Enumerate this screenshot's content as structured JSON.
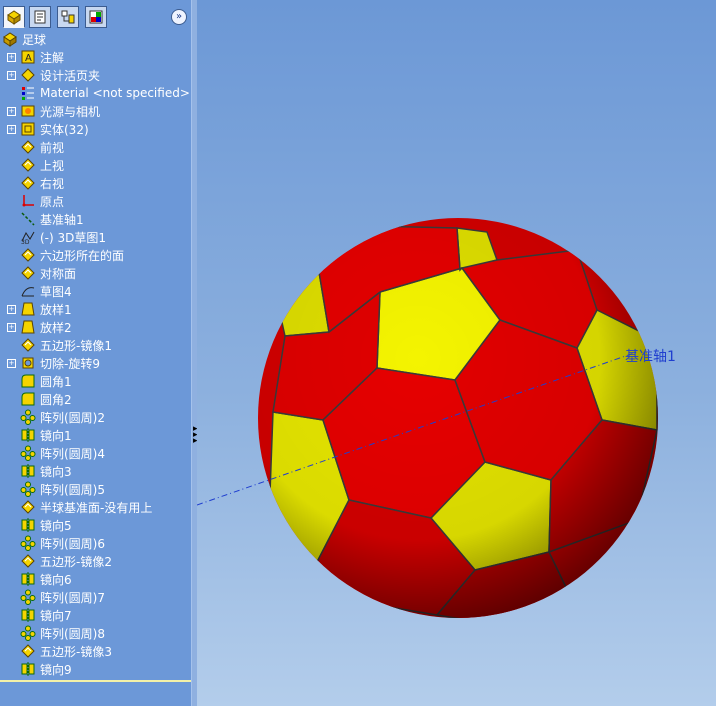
{
  "colors": {
    "panel": "#6c98d8",
    "ball_red": "#e00000",
    "ball_yellow": "#f0f000",
    "axis": "#1f3ecf"
  },
  "toolbar": {
    "tabs": [
      {
        "icon": "feature-manager-icon"
      },
      {
        "icon": "property-manager-icon"
      },
      {
        "icon": "configuration-manager-icon"
      },
      {
        "icon": "display-manager-icon"
      }
    ],
    "expand_glyph": "»"
  },
  "tree": {
    "items": [
      {
        "label": "足球",
        "icon": "part-icon",
        "expandable": false
      },
      {
        "label": "注解",
        "icon": "annotations-icon",
        "expandable": true
      },
      {
        "label": "设计活页夹",
        "icon": "design-binder-icon",
        "expandable": true
      },
      {
        "label": "Material <not specified>",
        "icon": "material-icon",
        "expandable": false
      },
      {
        "label": "光源与相机",
        "icon": "lights-cameras-icon",
        "expandable": true
      },
      {
        "label": "实体(32)",
        "icon": "solid-bodies-icon",
        "expandable": true
      },
      {
        "label": "前视",
        "icon": "plane-icon",
        "expandable": false
      },
      {
        "label": "上视",
        "icon": "plane-icon",
        "expandable": false
      },
      {
        "label": "右视",
        "icon": "plane-icon",
        "expandable": false
      },
      {
        "label": "原点",
        "icon": "origin-icon",
        "expandable": false
      },
      {
        "label": "基准轴1",
        "icon": "axis-icon",
        "expandable": false
      },
      {
        "label": "(-) 3D草图1",
        "icon": "sketch3d-icon",
        "expandable": false
      },
      {
        "label": "六边形所在的面",
        "icon": "plane-icon",
        "expandable": false
      },
      {
        "label": "对称面",
        "icon": "plane-icon",
        "expandable": false
      },
      {
        "label": "草图4",
        "icon": "sketch-icon",
        "expandable": false
      },
      {
        "label": "放样1",
        "icon": "loft-icon",
        "expandable": true
      },
      {
        "label": "放样2",
        "icon": "loft-icon",
        "expandable": true
      },
      {
        "label": "五边形-镜像1",
        "icon": "plane-icon",
        "expandable": false
      },
      {
        "label": "切除-旋转9",
        "icon": "cut-revolve-icon",
        "expandable": true
      },
      {
        "label": "圆角1",
        "icon": "fillet-icon",
        "expandable": false
      },
      {
        "label": "圆角2",
        "icon": "fillet-icon",
        "expandable": false
      },
      {
        "label": "阵列(圆周)2",
        "icon": "circular-pattern-icon",
        "expandable": false
      },
      {
        "label": "镜向1",
        "icon": "mirror-icon",
        "expandable": false
      },
      {
        "label": "阵列(圆周)4",
        "icon": "circular-pattern-icon",
        "expandable": false
      },
      {
        "label": "镜向3",
        "icon": "mirror-icon",
        "expandable": false
      },
      {
        "label": "阵列(圆周)5",
        "icon": "circular-pattern-icon",
        "expandable": false
      },
      {
        "label": "半球基准面-没有用上",
        "icon": "plane-icon",
        "expandable": false
      },
      {
        "label": "镜向5",
        "icon": "mirror-icon",
        "expandable": false
      },
      {
        "label": "阵列(圆周)6",
        "icon": "circular-pattern-icon",
        "expandable": false
      },
      {
        "label": "五边形-镜像2",
        "icon": "plane-icon",
        "expandable": false
      },
      {
        "label": "镜向6",
        "icon": "mirror-icon",
        "expandable": false
      },
      {
        "label": "阵列(圆周)7",
        "icon": "circular-pattern-icon",
        "expandable": false
      },
      {
        "label": "镜向7",
        "icon": "mirror-icon",
        "expandable": false
      },
      {
        "label": "阵列(圆周)8",
        "icon": "circular-pattern-icon",
        "expandable": false
      },
      {
        "label": "五边形-镜像3",
        "icon": "plane-icon",
        "expandable": false
      },
      {
        "label": "镜向9",
        "icon": "mirror-icon",
        "expandable": false
      }
    ]
  },
  "viewport": {
    "axis_label": "基准轴1",
    "model": "soccer-ball"
  }
}
